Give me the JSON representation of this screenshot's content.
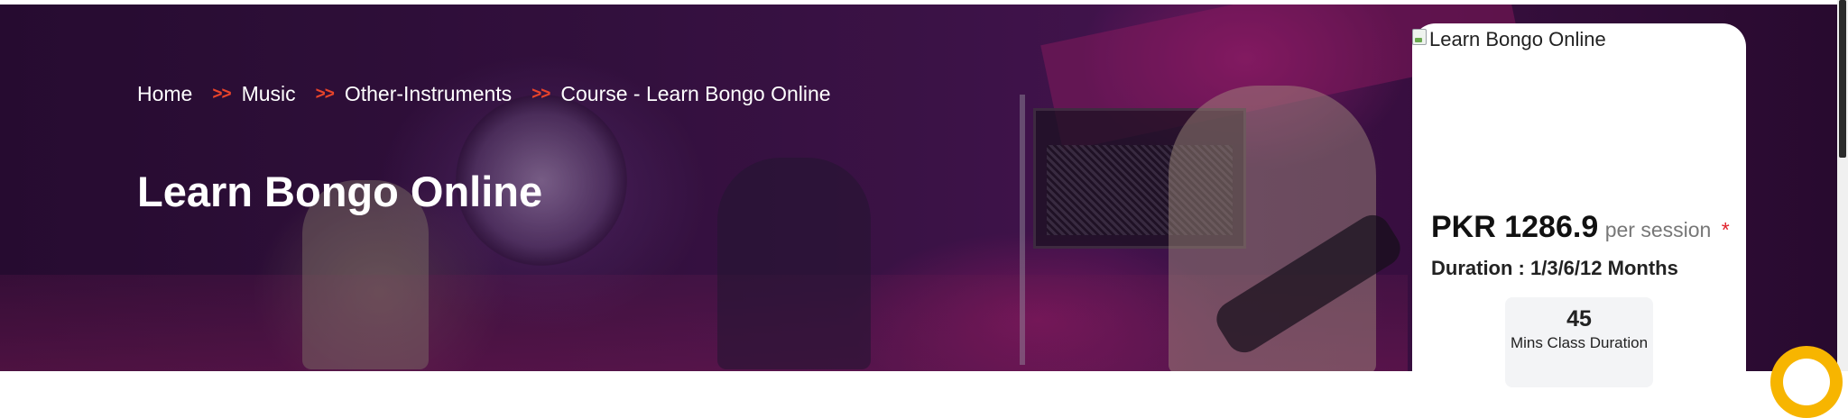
{
  "breadcrumb": {
    "separator": ">>",
    "items": [
      "Home",
      "Music",
      "Other-Instruments",
      "Course - Learn Bongo Online"
    ]
  },
  "page_title": "Learn Bongo Online",
  "course_card": {
    "image_alt": "Learn Bongo Online",
    "price": "PKR 1286.9",
    "price_unit": "per session",
    "required_mark": "*",
    "duration": "Duration : 1/3/6/12 Months",
    "stat_value": "45",
    "stat_label": "Mins Class Duration"
  },
  "colors": {
    "accent": "#e8442a",
    "required": "#e0202a",
    "hero_base": "#3a1346",
    "chat_widget": "#f7b500"
  },
  "icons": {
    "broken_image": "broken-image-icon",
    "chat": "chat-widget-icon"
  }
}
